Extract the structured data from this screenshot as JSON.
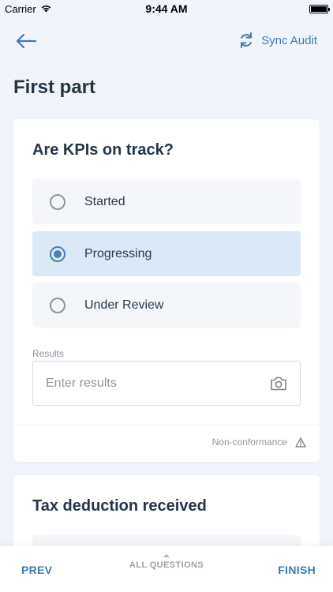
{
  "status_bar": {
    "carrier": "Carrier",
    "time": "9:44 AM",
    "icons": [
      "wifi-icon",
      "battery-icon"
    ]
  },
  "nav": {
    "back_icon": "arrow-left-icon",
    "sync_icon": "sync-icon",
    "sync_label": "Sync Audit"
  },
  "page": {
    "title": "First part"
  },
  "question1": {
    "title": "Are KPIs on track?",
    "options": [
      {
        "label": "Started",
        "selected": false
      },
      {
        "label": "Progressing",
        "selected": true
      },
      {
        "label": "Under Review",
        "selected": false
      }
    ],
    "results_label": "Results",
    "results_placeholder": "Enter results",
    "results_value": "",
    "camera_icon": "camera-icon",
    "nonconformance_label": "Non-conformance",
    "warning_icon": "warning-icon"
  },
  "question2": {
    "title": "Tax deduction received"
  },
  "bottom_bar": {
    "prev_label": "PREV",
    "all_questions_label": "ALL QUESTIONS",
    "finish_label": "FINISH"
  },
  "colors": {
    "accent": "#3f79b6",
    "background": "#f1f5fb",
    "selected_option_bg": "#dbe9f6",
    "option_bg": "#f4f6f9",
    "title_text": "#243447",
    "muted_text": "#8f979f"
  }
}
